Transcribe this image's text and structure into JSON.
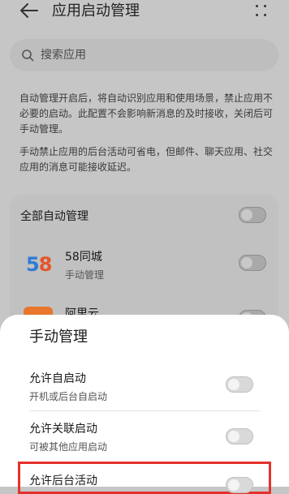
{
  "header": {
    "title": "应用启动管理",
    "back_icon": "arrow-left-icon",
    "more_icon": "more-dots-icon"
  },
  "search": {
    "placeholder": "搜索应用",
    "icon": "search-icon"
  },
  "description": {
    "p1": "自动管理开启后，将自动识别应用和使用场景，禁止应用不必要的启动。此配置不会影响新消息的及时接收，关闭后可手动管理。",
    "p2": "手动禁止应用的后台活动可省电，但邮件、聊天应用、社交应用的消息可能接收延迟。"
  },
  "app_list": {
    "all_auto": {
      "label": "全部自动管理",
      "enabled": false
    },
    "apps": [
      {
        "name": "58同城",
        "status": "手动管理",
        "logo_digit_1": "5",
        "logo_digit_2": "8",
        "enabled": false
      },
      {
        "name": "阿里云",
        "status": "",
        "enabled": false
      }
    ]
  },
  "sheet": {
    "title": "手动管理",
    "options": [
      {
        "label": "允许自启动",
        "sub": "开机或后台自启动",
        "enabled": false
      },
      {
        "label": "允许关联启动",
        "sub": "可被其他应用启动",
        "enabled": false
      },
      {
        "label": "允许后台活动",
        "sub": "",
        "enabled": false
      }
    ]
  },
  "colors": {
    "highlight": "#e5312b",
    "logo_blue": "#2f7bd6",
    "logo_red": "#e6552b",
    "aliyun_orange": "#e8762c"
  }
}
